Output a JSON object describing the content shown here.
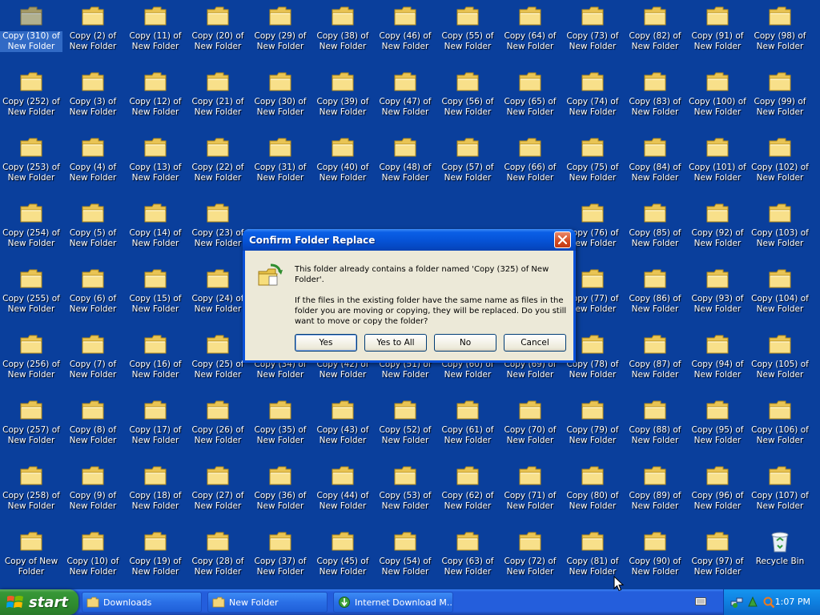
{
  "desktop": {
    "rows": [
      [
        "Copy (310) of New Folder",
        "Copy (2) of New Folder",
        "Copy (11) of New Folder",
        "Copy (20) of New Folder",
        "Copy (29) of New Folder",
        "Copy (38) of New Folder",
        "Copy (46) of New Folder",
        "Copy (55) of New Folder",
        "Copy (64) of New Folder",
        "Copy (73) of New Folder",
        "Copy (82) of New Folder",
        "Copy (91) of New Folder",
        "Copy (98) of New Folder"
      ],
      [
        "Copy (252) of New Folder",
        "Copy (3) of New Folder",
        "Copy (12) of New Folder",
        "Copy (21) of New Folder",
        "Copy (30) of New Folder",
        "Copy (39) of New Folder",
        "Copy (47) of New Folder",
        "Copy (56) of New Folder",
        "Copy (65) of New Folder",
        "Copy (74) of New Folder",
        "Copy (83) of New Folder",
        "Copy (100) of New Folder",
        "Copy (99) of New Folder"
      ],
      [
        "Copy (253) of New Folder",
        "Copy (4) of New Folder",
        "Copy (13) of New Folder",
        "Copy (22) of New Folder",
        "Copy (31) of New Folder",
        "Copy (40) of New Folder",
        "Copy (48) of New Folder",
        "Copy (57) of New Folder",
        "Copy (66) of New Folder",
        "Copy (75) of New Folder",
        "Copy (84) of New Folder",
        "Copy (101) of New Folder",
        "Copy (102) of New Folder"
      ],
      [
        "Copy (254) of New Folder",
        "Copy (5) of New Folder",
        "Copy (14) of New Folder",
        "Copy (23) of New Folder",
        "",
        "",
        "",
        "",
        "",
        "Copy (76) of New Folder",
        "Copy (85) of New Folder",
        "Copy (92) of New Folder",
        "Copy (103) of New Folder"
      ],
      [
        "Copy (255) of New Folder",
        "Copy (6) of New Folder",
        "Copy (15) of New Folder",
        "Copy (24) of New Folder",
        "",
        "",
        "",
        "",
        "",
        "Copy (77) of New Folder",
        "Copy (86) of New Folder",
        "Copy (93) of New Folder",
        "Copy (104) of New Folder"
      ],
      [
        "Copy (256) of New Folder",
        "Copy (7) of New Folder",
        "Copy (16) of New Folder",
        "Copy (25) of New Folder",
        "Copy (34) of New Folder",
        "Copy (42) of New Folder",
        "Copy (51) of New Folder",
        "Copy (60) of New Folder",
        "Copy (69) of New Folder",
        "Copy (78) of New Folder",
        "Copy (87) of New Folder",
        "Copy (94) of New Folder",
        "Copy (105) of New Folder"
      ],
      [
        "Copy (257) of New Folder",
        "Copy (8) of New Folder",
        "Copy (17) of New Folder",
        "Copy (26) of New Folder",
        "Copy (35) of New Folder",
        "Copy (43) of New Folder",
        "Copy (52) of New Folder",
        "Copy (61) of New Folder",
        "Copy (70) of New Folder",
        "Copy (79) of New Folder",
        "Copy (88) of New Folder",
        "Copy (95) of New Folder",
        "Copy (106) of New Folder"
      ],
      [
        "Copy (258) of New Folder",
        "Copy (9) of New Folder",
        "Copy (18) of New Folder",
        "Copy (27) of New Folder",
        "Copy (36) of New Folder",
        "Copy (44) of New Folder",
        "Copy (53) of New Folder",
        "Copy (62) of New Folder",
        "Copy (71) of New Folder",
        "Copy (80) of New Folder",
        "Copy (89) of New Folder",
        "Copy (96) of New Folder",
        "Copy (107) of New Folder"
      ],
      [
        "Copy of New Folder",
        "Copy (10) of New Folder",
        "Copy (19) of New Folder",
        "Copy (28) of New Folder",
        "Copy (37) of New Folder",
        "Copy (45) of New Folder",
        "Copy (54) of New Folder",
        "Copy (63) of New Folder",
        "Copy (72) of New Folder",
        "Copy (81) of New Folder",
        "Copy (90) of New Folder",
        "Copy (97) of New Folder",
        "Recycle Bin"
      ]
    ],
    "selected": "Copy (310) of New Folder",
    "recycle_bin_label": "Recycle Bin",
    "background_color": "#0a3f9c",
    "folder_icon": "folder-icon"
  },
  "dialog": {
    "title": "Confirm Folder Replace",
    "message_line1": "This folder already contains a folder named 'Copy (325) of New Folder'.",
    "message_line2": "If the files in the existing folder have the same name as files in the folder you are moving or copying, they will be replaced.  Do you still want to move or copy the folder?",
    "buttons": {
      "yes": "Yes",
      "yes_to_all": "Yes to All",
      "no": "No",
      "cancel": "Cancel"
    },
    "icon": "folder-replace-icon"
  },
  "taskbar": {
    "start_label": "start",
    "tasks": [
      {
        "label": "Downloads",
        "icon": "folder-icon"
      },
      {
        "label": "New Folder",
        "icon": "folder-icon"
      },
      {
        "label": "Internet Download M...",
        "icon": "globe-download-icon"
      }
    ],
    "clock": "1:07 PM",
    "tray_icons": [
      "network-icon",
      "app-icon",
      "search-icon"
    ]
  }
}
